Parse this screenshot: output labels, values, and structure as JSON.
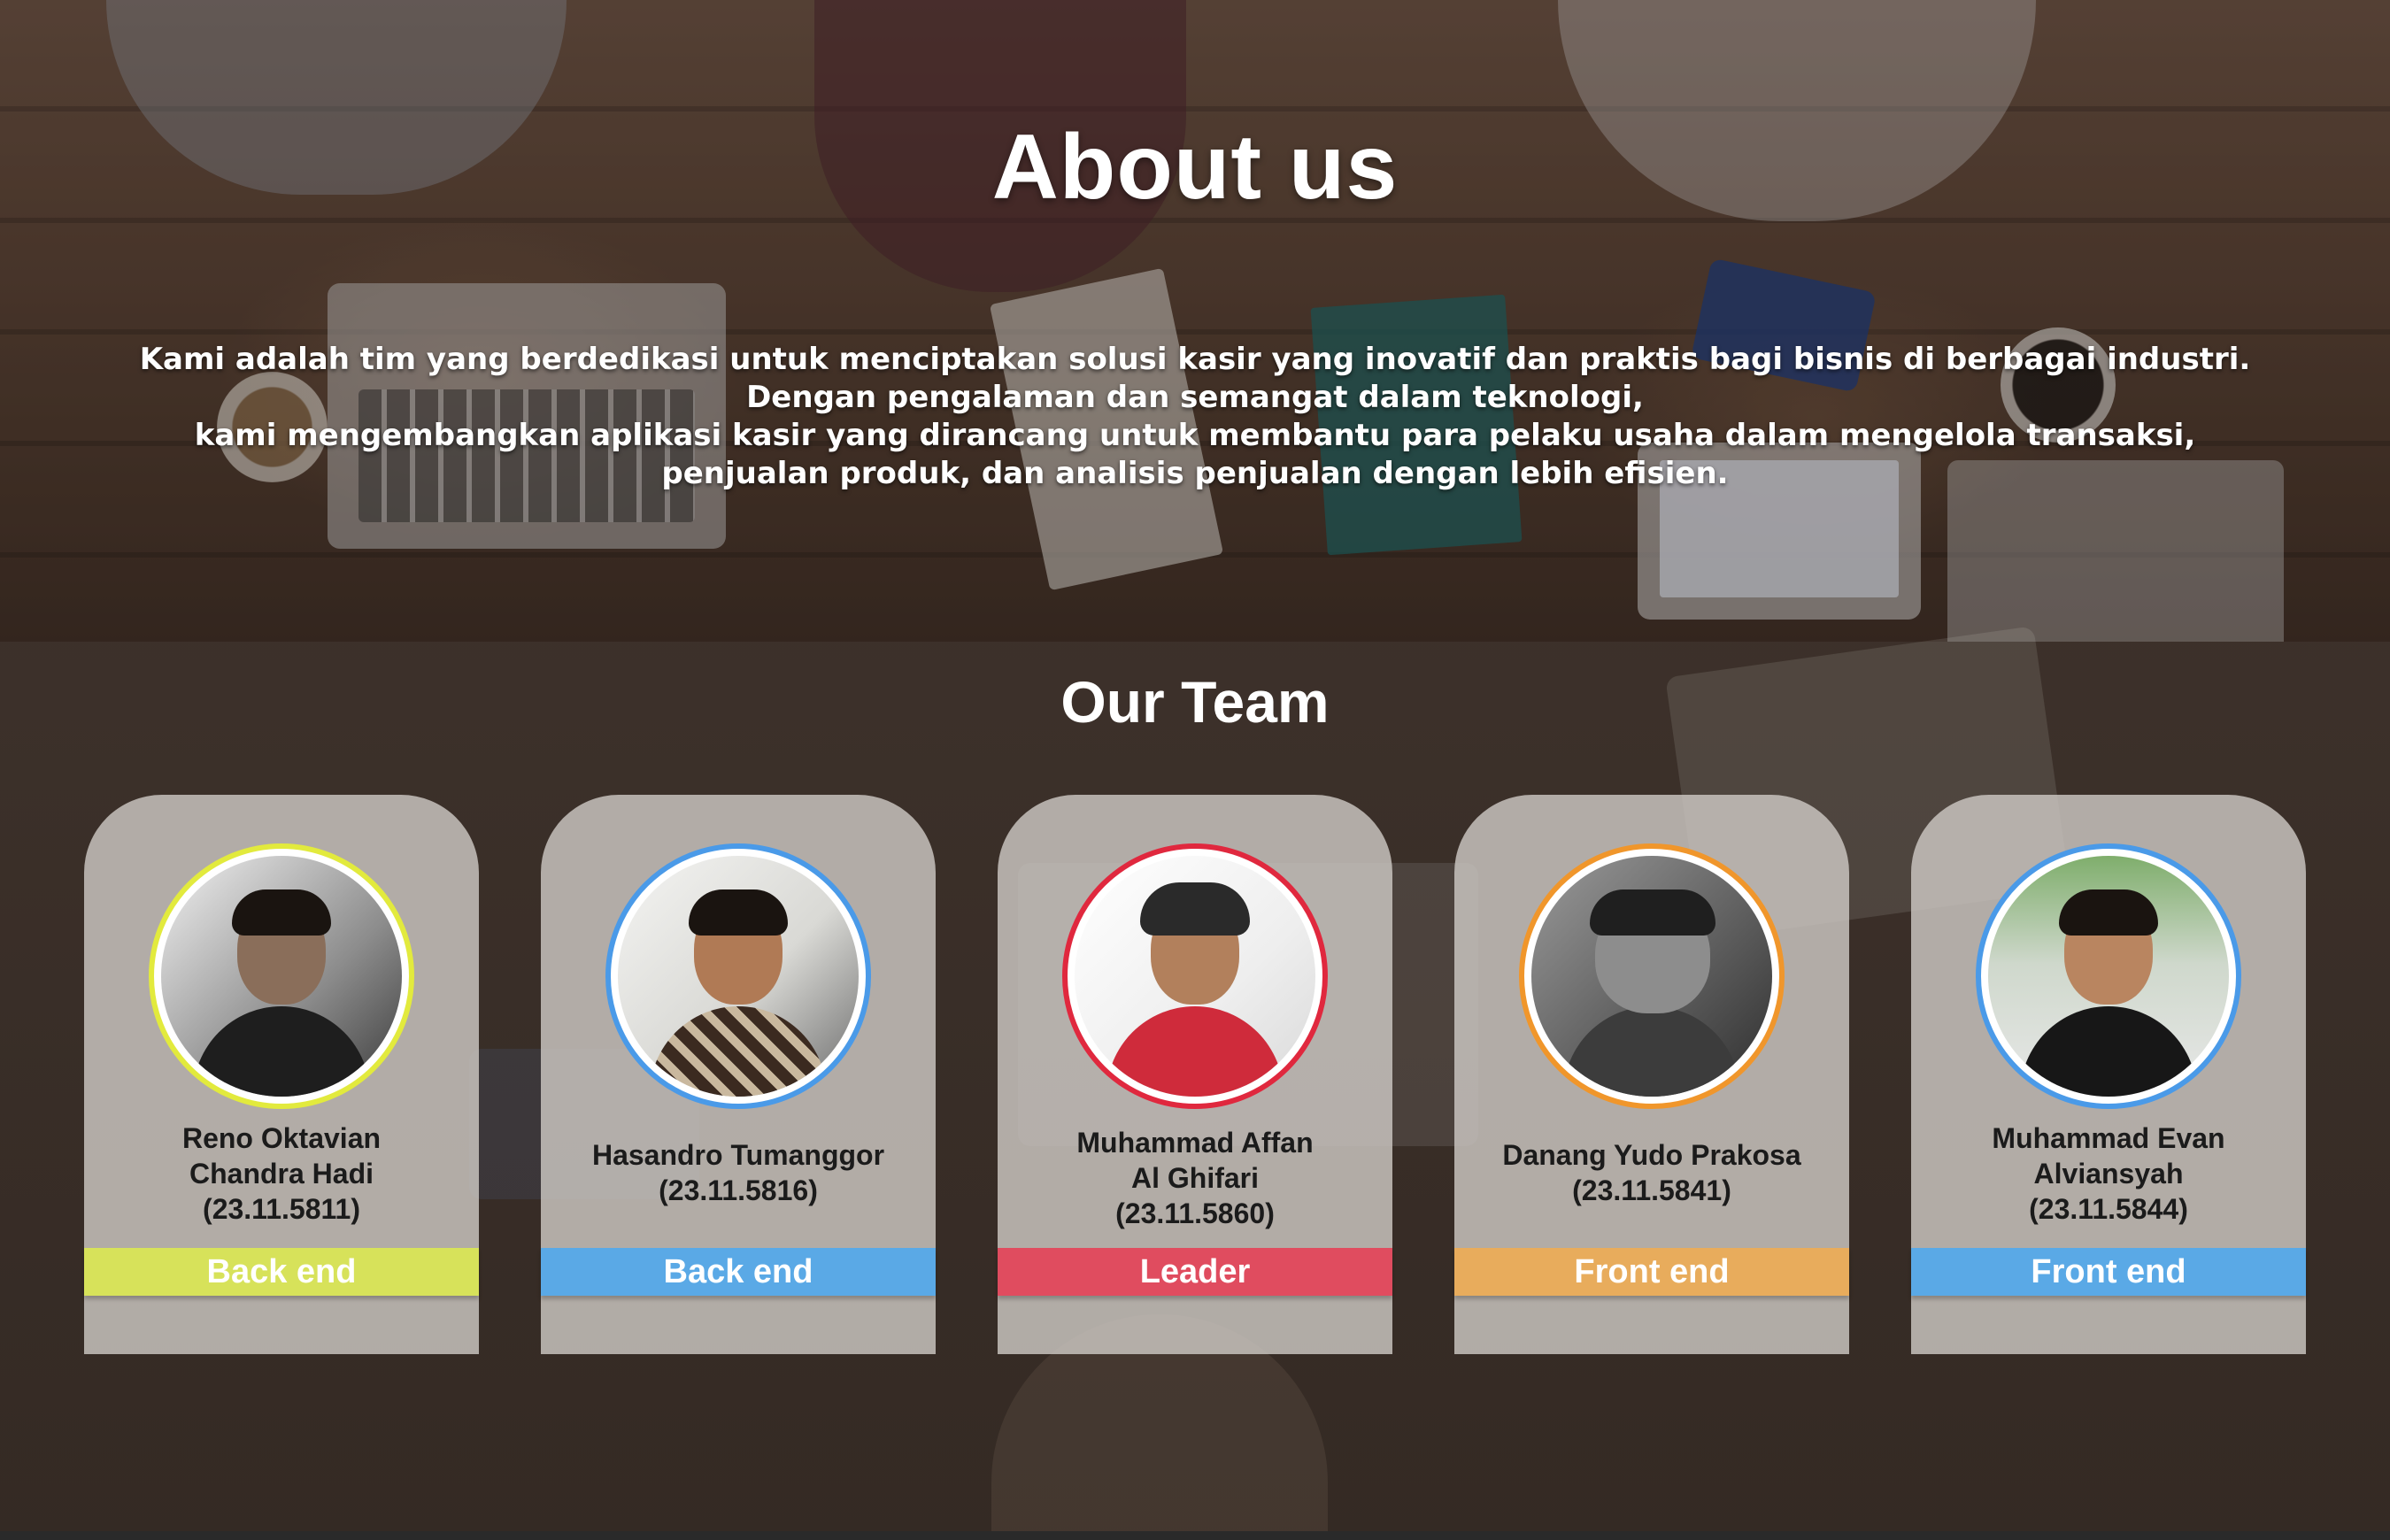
{
  "hero": {
    "title": "About us",
    "lines": [
      "Kami adalah tim yang berdedikasi untuk menciptakan solusi kasir yang inovatif dan praktis bagi bisnis di berbagai industri.",
      "Dengan pengalaman dan semangat dalam teknologi,",
      "kami mengembangkan aplikasi kasir yang dirancang untuk membantu para pelaku usaha dalam mengelola transaksi,",
      "penjualan produk, dan analisis penjualan dengan lebih efisien."
    ]
  },
  "team": {
    "title": "Our Team",
    "members": [
      {
        "name_lines": [
          "Reno Oktavian",
          "Chandra Hadi",
          "(23.11.5811)"
        ],
        "role": "Back end",
        "accent": "#d7e25a",
        "ring": "#e2ea3d"
      },
      {
        "name_lines": [
          "Hasandro Tumanggor",
          "(23.11.5816)"
        ],
        "role": "Back end",
        "accent": "#5aa9e6",
        "ring": "#4a9ae8"
      },
      {
        "name_lines": [
          "Muhammad Affan",
          "Al Ghifari",
          "(23.11.5860)"
        ],
        "role": "Leader",
        "accent": "#e04c5f",
        "ring": "#e0283e"
      },
      {
        "name_lines": [
          "Danang Yudo Prakosa",
          "(23.11.5841)"
        ],
        "role": "Front end",
        "accent": "#e8ac5c",
        "ring": "#f0962b"
      },
      {
        "name_lines": [
          "Muhammad Evan",
          "Alviansyah",
          "(23.11.5844)"
        ],
        "role": "Front end",
        "accent": "#5aa9e6",
        "ring": "#4a9ae8"
      }
    ]
  }
}
